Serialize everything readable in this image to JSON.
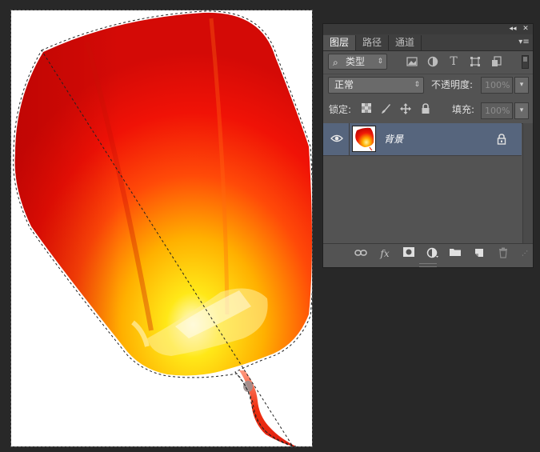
{
  "panel": {
    "topbar": {
      "collapse_icon": "◂◂",
      "close_icon": "✕"
    },
    "tabs": [
      {
        "label": "图层",
        "active": true
      },
      {
        "label": "路径",
        "active": false
      },
      {
        "label": "通道",
        "active": false
      }
    ],
    "menu_icon": "▾≡",
    "filter": {
      "kind_label": "类型",
      "icons": [
        "image-filter-icon",
        "adjustment-filter-icon",
        "type-filter-icon",
        "shape-filter-icon",
        "smart-object-filter-icon"
      ]
    },
    "blend_mode": "正常",
    "opacity_label": "不透明度:",
    "opacity_value": "100%",
    "lock_label": "锁定:",
    "fill_label": "填充:",
    "fill_value": "100%",
    "layers": [
      {
        "name": "背景",
        "visible": true,
        "locked": true,
        "selected": true
      }
    ],
    "bottom_icons": [
      "link-layers-icon",
      "fx-icon",
      "layer-mask-icon",
      "adjustment-layer-icon",
      "new-group-icon",
      "new-layer-icon",
      "delete-layer-icon"
    ],
    "fx_label": "fx"
  },
  "colors": {
    "app_background": "#282828",
    "panel_background": "#535353",
    "selected_layer": "#56657d",
    "lantern_red": "#ef0f05",
    "lantern_glow": "#ffe21a"
  }
}
